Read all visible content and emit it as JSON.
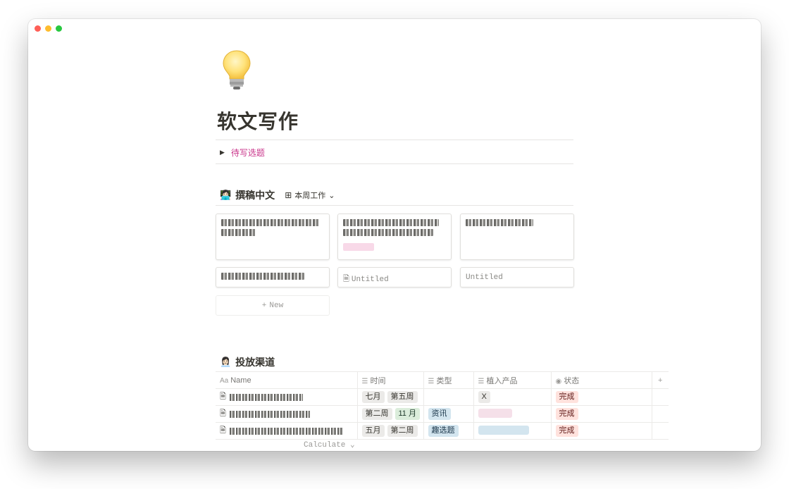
{
  "page": {
    "icon": "lightbulb-icon",
    "title": "软文写作",
    "toggle_label": "待写选题"
  },
  "board": {
    "emoji": "👩🏻‍💻",
    "title": "撰稿中文",
    "view_label": "本周工作",
    "cards": [
      {
        "untitled": false,
        "lines": 2,
        "tag": false
      },
      {
        "untitled": false,
        "lines": 2,
        "tag": true
      },
      {
        "untitled": false,
        "lines": 1,
        "tag": false
      },
      {
        "untitled": false,
        "lines": 1,
        "tag": false
      },
      {
        "untitled": true,
        "title": "Untitled"
      },
      {
        "untitled": true,
        "title": "Untitled"
      }
    ],
    "new_label": "New"
  },
  "table": {
    "emoji": "👩🏻‍💼",
    "title": "投放渠道",
    "columns": {
      "name": "Name",
      "time": "时间",
      "type": "类型",
      "product": "植入产品",
      "status": "状态"
    },
    "rows": [
      {
        "time": [
          "七月",
          "第五周"
        ],
        "type": "",
        "product": "X",
        "status": "完成"
      },
      {
        "time": [
          "第二周",
          "11 月"
        ],
        "type": "资讯",
        "product": "",
        "status": "完成"
      },
      {
        "time": [
          "五月",
          "第二周"
        ],
        "type": "趣选题",
        "product": "",
        "status": "完成"
      }
    ],
    "calculate_label": "Calculate"
  },
  "colors": {
    "accent_pink": "#c9358b",
    "status_done_bg": "#ffe2dd"
  }
}
